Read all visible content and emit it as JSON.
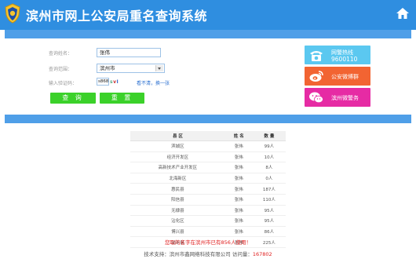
{
  "header": {
    "title": "滨州市网上公安局重名查询系统"
  },
  "form": {
    "name_label": "查询姓名：",
    "name_value": "张伟",
    "range_label": "查询范围：",
    "range_value": "滨州市",
    "captcha_label": "输入验证码：",
    "captcha_value": "s868",
    "captcha_chars": [
      "s",
      "v",
      "I"
    ],
    "refresh_link": "看不清，换一张",
    "query_button": "查 询",
    "reset_button": "重 置"
  },
  "side": {
    "hotline_label": "网警热线",
    "hotline_number": "9600110",
    "weibo_label": "公安微博群",
    "wechat_label": "滨州微警务"
  },
  "table": {
    "headers": [
      "县 区",
      "姓 名",
      "数 量"
    ],
    "rows": [
      [
        "滨城区",
        "张伟",
        "99人"
      ],
      [
        "经济开发区",
        "张伟",
        "10人"
      ],
      [
        "高新技术产业开发区",
        "张伟",
        "8人"
      ],
      [
        "北海新区",
        "张伟",
        "0人"
      ],
      [
        "惠民县",
        "张伟",
        "187人"
      ],
      [
        "阳信县",
        "张伟",
        "110人"
      ],
      [
        "无棣县",
        "张伟",
        "95人"
      ],
      [
        "沾化区",
        "张伟",
        "95人"
      ],
      [
        "博兴县",
        "张伟",
        "86人"
      ],
      [
        "邹平县",
        "张伟",
        "225人"
      ]
    ]
  },
  "notice": "您取的名字在滨州市已有856人使用！",
  "footer": {
    "text": "技术支持：滨州市鑫网络科技有限公司  访问量：",
    "count": "167802"
  },
  "colors": {
    "header": "#2f8ee0",
    "strip": "#4f9fe8",
    "button": "#3bd12a",
    "hotline": "#5bc8f0",
    "weibo": "#f26432",
    "wechat": "#e62ba4"
  }
}
